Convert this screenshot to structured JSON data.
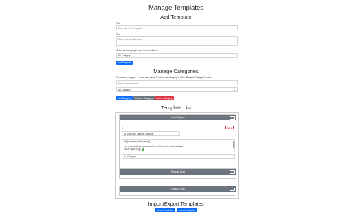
{
  "page": {
    "title": "Manage Templates"
  },
  "add_template": {
    "heading": "Add Template",
    "title_label": "Title",
    "title_placeholder": "Enter title of the template",
    "text_label": "Text",
    "text_placeholder": "Enter your template text",
    "category_label": "Select the category to save the template in",
    "category_value": "No Category",
    "add_button": "Add Template"
  },
  "manage_categories": {
    "heading": "Manage Categories",
    "instructions": "To rename category: 1. Enter new name 2. Select the category 3. Click \"Rename Category\" button",
    "name_placeholder": "Enter category name",
    "select_value": "No Category",
    "add_button": "Add Category",
    "rename_button": "Rename Category",
    "delete_button": "Delete Category"
  },
  "template_list": {
    "heading": "Template List",
    "categories": [
      {
        "name": "No Category",
        "toggle": "−",
        "templates": [
          {
            "index": "1",
            "delete_label": "Delete",
            "title": "No Category Sample Template",
            "text_line1": "Hi {{customer_first_name}},",
            "text_line2": "I've reviewed your account and everything is in perfect shape.",
            "text_line3": "You're good to go",
            "emoji": "✓",
            "category": "No Category"
          }
        ]
      },
      {
        "name": "Spanish Chat",
        "toggle": "+"
      },
      {
        "name": "English Chat",
        "toggle": "+"
      }
    ]
  },
  "import_export": {
    "heading": "Import/Export Templates",
    "export_button": "Export Templates",
    "import_button": "Import Templates"
  },
  "colors": {
    "primary": "#0d6efd",
    "secondary": "#6c757d",
    "danger": "#dc3545",
    "emoji_bg": "#4caf50"
  }
}
